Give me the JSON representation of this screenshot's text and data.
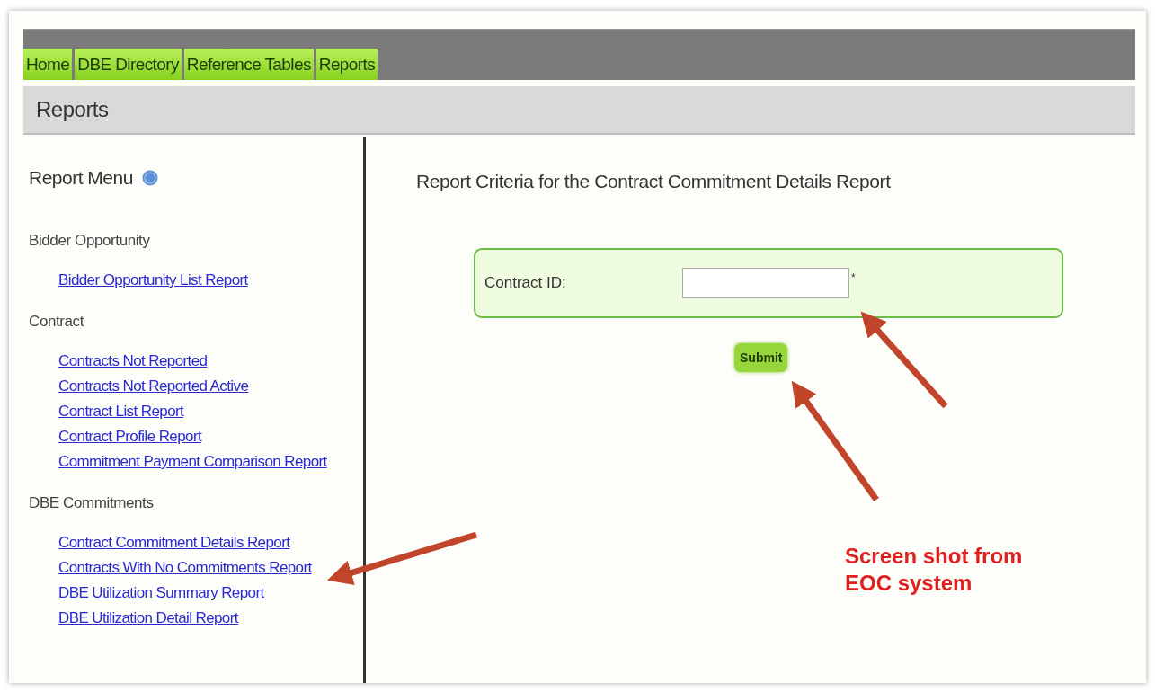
{
  "nav_tabs": [
    {
      "label": "Home"
    },
    {
      "label": "DBE Directory"
    },
    {
      "label": "Reference Tables"
    },
    {
      "label": "Reports"
    }
  ],
  "page_title": "Reports",
  "sidebar": {
    "title": "Report Menu",
    "sections": [
      {
        "heading": "Bidder Opportunity",
        "links": [
          "Bidder Opportunity List Report"
        ]
      },
      {
        "heading": "Contract",
        "links": [
          "Contracts Not Reported",
          "Contracts Not Reported Active",
          "Contract List Report",
          "Contract Profile Report",
          "Commitment Payment Comparison Report"
        ]
      },
      {
        "heading": "DBE Commitments",
        "links": [
          "Contract Commitment Details Report",
          "Contracts With No Commitments Report",
          "DBE Utilization Summary Report",
          "DBE Utilization Detail Report"
        ]
      }
    ]
  },
  "main": {
    "heading": "Report Criteria for the Contract Commitment Details Report",
    "field_label": "Contract ID:",
    "required_mark": "*",
    "submit": "Submit"
  },
  "annotation": "Screen shot from EOC system"
}
